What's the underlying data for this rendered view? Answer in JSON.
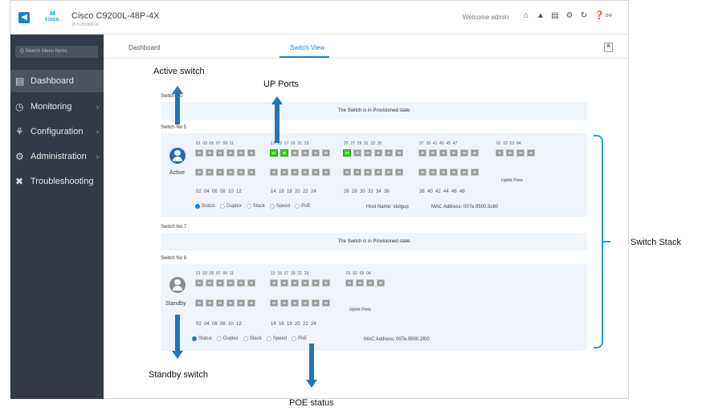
{
  "header": {
    "device_name": "Cisco C9200L-48P-4X",
    "device_version": "16.9.20180619",
    "brand": "cisco",
    "welcome": "Welcome admin"
  },
  "sidebar": {
    "search_placeholder": "Q Search Menu Items",
    "items": [
      {
        "label": "Dashboard",
        "icon": "dashboard-icon",
        "active": true
      },
      {
        "label": "Monitoring",
        "icon": "monitoring-icon"
      },
      {
        "label": "Configuration",
        "icon": "wrench-icon"
      },
      {
        "label": "Administration",
        "icon": "gear-icon"
      },
      {
        "label": "Troubleshooting",
        "icon": "tools-icon"
      }
    ]
  },
  "tabs": [
    {
      "label": "Dashboard",
      "selected": false
    },
    {
      "label": "Switch View",
      "selected": true
    }
  ],
  "switches": {
    "sw_top_label": "Switch No",
    "sw_top_state": "The Switch is in Provisioned state",
    "sw5_label": "Switch No 5",
    "sw5_role": "Active",
    "sw5_uplink": "Uplink Ports",
    "sw5_host": "Host Name: stulgup",
    "sw5_mac": "MAC Address: 007e.9500.5c80",
    "sw5_top_a": "01  03  05  07  09  11",
    "sw5_top_b": "13  15  17  19  21  23",
    "sw5_top_c": "25  27  29  31  33  35",
    "sw5_top_d": "37  39  41  43  45  47",
    "sw5_top_e": "01  02  03  04",
    "sw5_bot_a": "02  04  06  08  10  12",
    "sw5_bot_b": "14  16  18  20  22  24",
    "sw5_bot_c": "26  28  30  32  34  36",
    "sw5_bot_d": "38  40  42  44  46  48",
    "sw7_label": "Switch No 7",
    "sw7_state": "The Switch is in Provisioned state",
    "sw8_label": "Switch No 8",
    "sw8_role": "Standby",
    "sw8_uplink": "Uplink Ports",
    "sw8_mac": "MAC Address: 007e.9500.2f00",
    "sw8_top_a": "01  03  05  07  09  11",
    "sw8_top_b": "13  15  17  19  21  23",
    "sw8_top_c": "01  02  03  04",
    "sw8_bot_a": "02  04  06  08  10  12",
    "sw8_bot_b": "14  16  18  20  22  24"
  },
  "view_options": [
    "Status",
    "Duplex",
    "Stack",
    "Speed",
    "PoE"
  ],
  "view_selected": "Status",
  "port_colors": {
    "up": "#33d017",
    "down": "#9a9a9a"
  },
  "callouts": {
    "active_switch": "Active switch",
    "up_ports": "UP Ports",
    "switch_stack": "Switch Stack",
    "standby_switch": "Standby switch",
    "poe_status": "POE status"
  }
}
